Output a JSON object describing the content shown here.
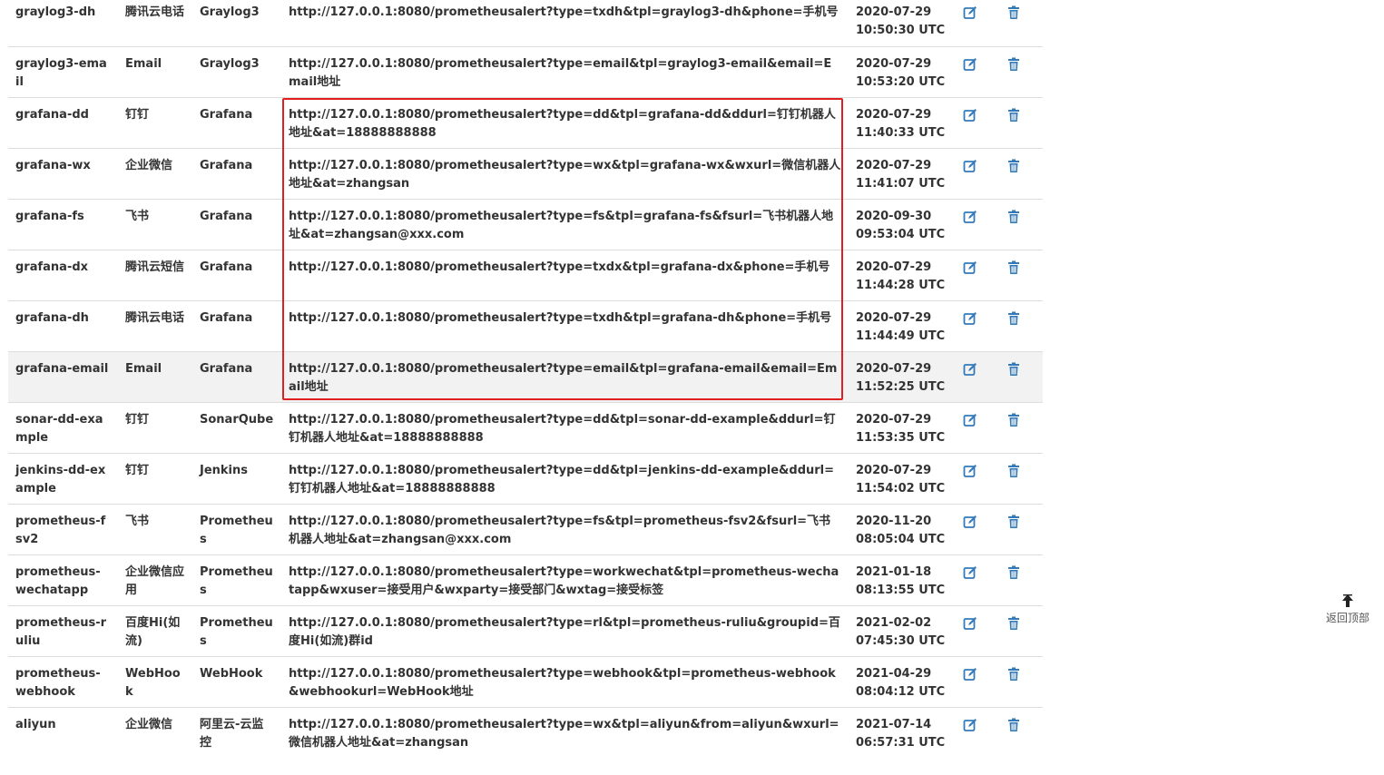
{
  "table": {
    "rows": [
      {
        "name": "graylog3-dh",
        "type": "腾讯云电话",
        "tpl": "Graylog3",
        "url": "http://127.0.0.1:8080/prometheusalert?type=txdh&tpl=graylog3-dh&phone=手机号",
        "date": "2020-07-29",
        "time": "10:50:30 UTC"
      },
      {
        "name": "graylog3-email",
        "type": "Email",
        "tpl": "Graylog3",
        "url": "http://127.0.0.1:8080/prometheusalert?type=email&tpl=graylog3-email&email=Email地址",
        "date": "2020-07-29",
        "time": "10:53:20 UTC"
      },
      {
        "name": "grafana-dd",
        "type": "钉钉",
        "tpl": "Grafana",
        "url": "http://127.0.0.1:8080/prometheusalert?type=dd&tpl=grafana-dd&ddurl=钉钉机器人地址&at=18888888888",
        "date": "2020-07-29",
        "time": "11:40:33 UTC"
      },
      {
        "name": "grafana-wx",
        "type": "企业微信",
        "tpl": "Grafana",
        "url": "http://127.0.0.1:8080/prometheusalert?type=wx&tpl=grafana-wx&wxurl=微信机器人地址&at=zhangsan",
        "date": "2020-07-29",
        "time": "11:41:07 UTC"
      },
      {
        "name": "grafana-fs",
        "type": "飞书",
        "tpl": "Grafana",
        "url": "http://127.0.0.1:8080/prometheusalert?type=fs&tpl=grafana-fs&fsurl=飞书机器人地址&at=zhangsan@xxx.com",
        "date": "2020-09-30",
        "time": "09:53:04 UTC"
      },
      {
        "name": "grafana-dx",
        "type": "腾讯云短信",
        "tpl": "Grafana",
        "url": "http://127.0.0.1:8080/prometheusalert?type=txdx&tpl=grafana-dx&phone=手机号",
        "date": "2020-07-29",
        "time": "11:44:28 UTC"
      },
      {
        "name": "grafana-dh",
        "type": "腾讯云电话",
        "tpl": "Grafana",
        "url": "http://127.0.0.1:8080/prometheusalert?type=txdh&tpl=grafana-dh&phone=手机号",
        "date": "2020-07-29",
        "time": "11:44:49 UTC"
      },
      {
        "name": "grafana-email",
        "type": "Email",
        "tpl": "Grafana",
        "url": "http://127.0.0.1:8080/prometheusalert?type=email&tpl=grafana-email&email=Email地址",
        "date": "2020-07-29",
        "time": "11:52:25 UTC"
      },
      {
        "name": "sonar-dd-example",
        "type": "钉钉",
        "tpl": "SonarQube",
        "url": "http://127.0.0.1:8080/prometheusalert?type=dd&tpl=sonar-dd-example&ddurl=钉钉机器人地址&at=18888888888",
        "date": "2020-07-29",
        "time": "11:53:35 UTC"
      },
      {
        "name": "jenkins-dd-example",
        "type": "钉钉",
        "tpl": "Jenkins",
        "url": "http://127.0.0.1:8080/prometheusalert?type=dd&tpl=jenkins-dd-example&ddurl=钉钉机器人地址&at=18888888888",
        "date": "2020-07-29",
        "time": "11:54:02 UTC"
      },
      {
        "name": "prometheus-fsv2",
        "type": "飞书",
        "tpl": "Prometheus",
        "url": "http://127.0.0.1:8080/prometheusalert?type=fs&tpl=prometheus-fsv2&fsurl=飞书机器人地址&at=zhangsan@xxx.com",
        "date": "2020-11-20",
        "time": "08:05:04 UTC"
      },
      {
        "name": "prometheus-wechatapp",
        "type": "企业微信应用",
        "tpl": "Prometheus",
        "url": "http://127.0.0.1:8080/prometheusalert?type=workwechat&tpl=prometheus-wechatapp&wxuser=接受用户&wxparty=接受部门&wxtag=接受标签",
        "date": "2021-01-18",
        "time": "08:13:55 UTC"
      },
      {
        "name": "prometheus-ruliu",
        "type": "百度Hi(如流)",
        "tpl": "Prometheus",
        "url": "http://127.0.0.1:8080/prometheusalert?type=rl&tpl=prometheus-ruliu&groupid=百度Hi(如流)群id",
        "date": "2021-02-02",
        "time": "07:45:30 UTC"
      },
      {
        "name": "prometheus-webhook",
        "type": "WebHook",
        "tpl": "WebHook",
        "url": "http://127.0.0.1:8080/prometheusalert?type=webhook&tpl=prometheus-webhook&webhookurl=WebHook地址",
        "date": "2021-04-29",
        "time": "08:04:12 UTC"
      },
      {
        "name": "aliyun",
        "type": "企业微信",
        "tpl": "阿里云-云监控",
        "url": "http://127.0.0.1:8080/prometheusalert?type=wx&tpl=aliyun&from=aliyun&wxurl=微信机器人地址&at=zhangsan",
        "date": "2021-07-14",
        "time": "06:57:31 UTC"
      }
    ],
    "icons": {
      "edit": "edit-icon",
      "delete": "trash-icon"
    },
    "highlighted_row_index": 7
  },
  "back_to_top": {
    "label": "返回顶部",
    "icon": "arrow-up-icon"
  },
  "colors": {
    "icon_blue": "#337ab7",
    "highlight_border": "#e02020",
    "row_hover": "#f2f2f2"
  }
}
